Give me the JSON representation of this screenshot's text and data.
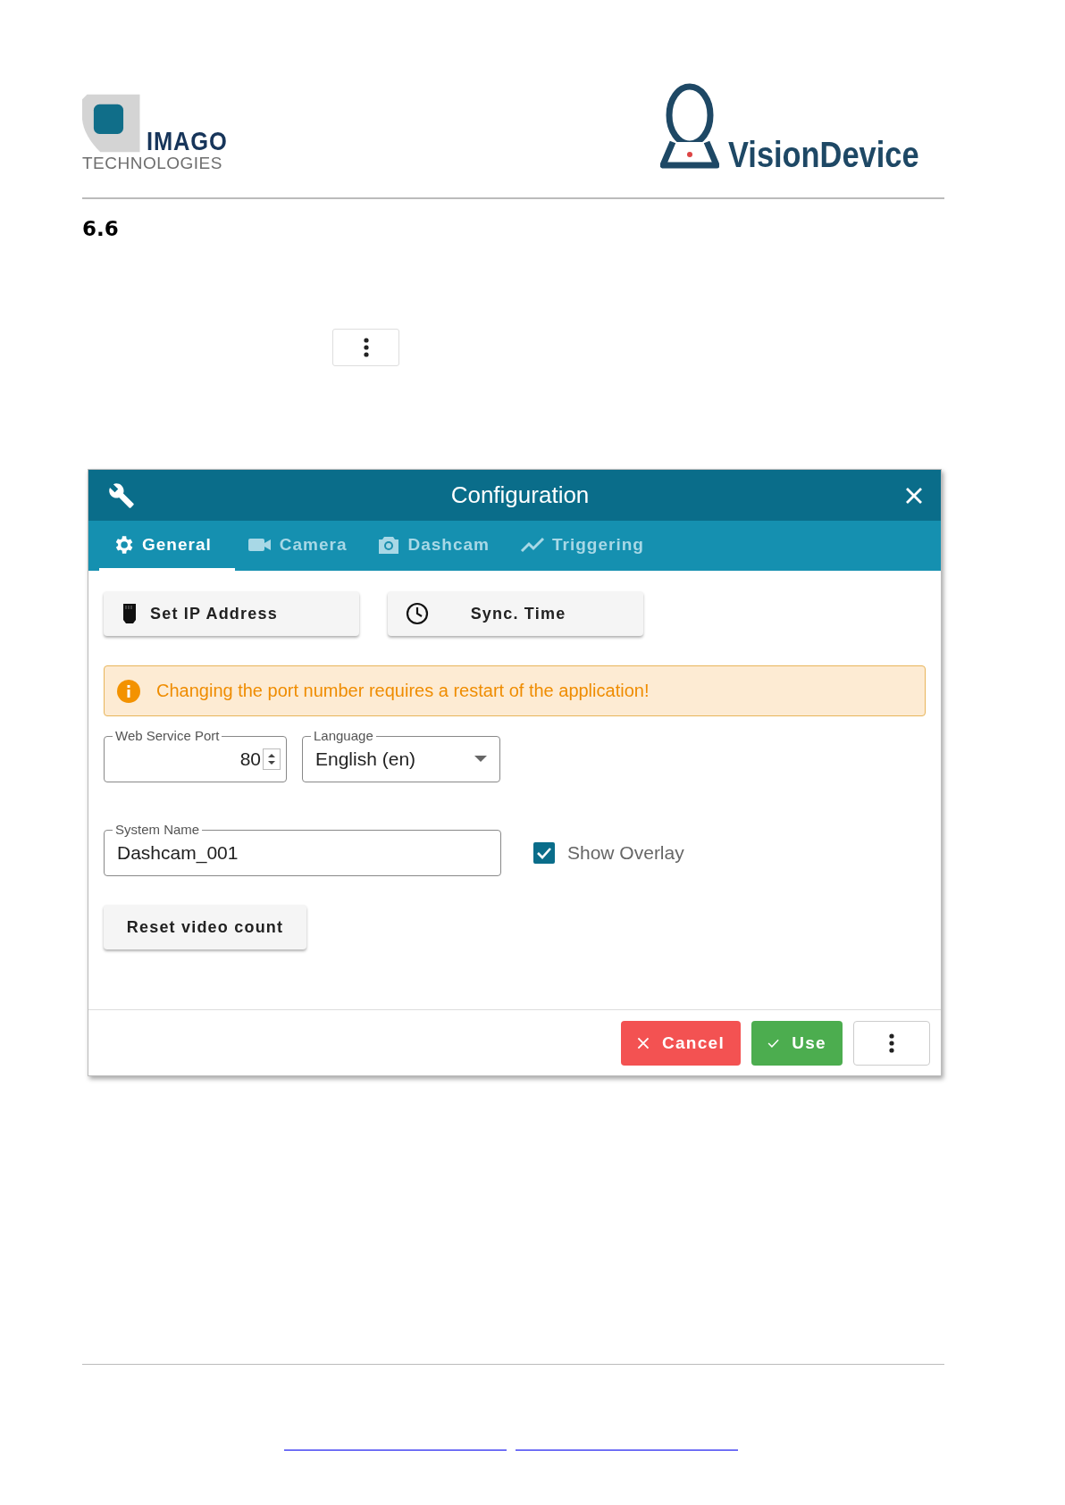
{
  "header": {
    "company_logo": {
      "name": "IMAGO",
      "subtitle": "TECHNOLOGIES"
    },
    "product_logo": {
      "name": "VisionDevice"
    }
  },
  "section": {
    "number": "6.6"
  },
  "dialog": {
    "title": "Configuration",
    "tabs": [
      {
        "label": "General",
        "kind": "gear",
        "selected": true
      },
      {
        "label": "Camera",
        "kind": "video",
        "selected": false
      },
      {
        "label": "Dashcam",
        "kind": "camera",
        "selected": false
      },
      {
        "label": "Triggering",
        "kind": "chart",
        "selected": false
      }
    ],
    "actions": [
      {
        "label": "Set IP Address",
        "kind": "ethernet"
      },
      {
        "label": "Sync. Time",
        "kind": "clock"
      }
    ],
    "alert": {
      "text": "Changing the port number requires a restart of the application!"
    },
    "port": {
      "label": "Web Service Port",
      "value": "80"
    },
    "language": {
      "label": "Language",
      "value": "English (en)"
    },
    "system_name": {
      "label": "System Name",
      "value": "Dashcam_001"
    },
    "show_overlay": {
      "label": "Show Overlay",
      "checked": true
    },
    "reset_button": {
      "label": "Reset video count"
    },
    "footer_buttons": [
      {
        "label": "Cancel",
        "kind": "cancel"
      },
      {
        "label": "Use",
        "kind": "use"
      },
      {
        "kind": "more"
      }
    ]
  }
}
